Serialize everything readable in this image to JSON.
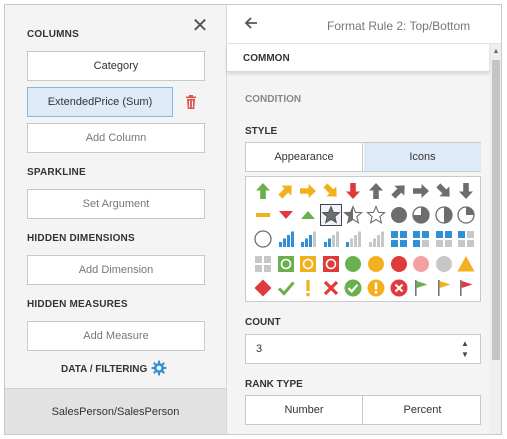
{
  "left_panel": {
    "columns_title": "COLUMNS",
    "columns": [
      "Category",
      "ExtendedPrice (Sum)"
    ],
    "add_column": "Add Column",
    "sparkline_title": "SPARKLINE",
    "set_argument": "Set Argument",
    "hidden_dimensions_title": "HIDDEN DIMENSIONS",
    "add_dimension": "Add Dimension",
    "hidden_measures_title": "HIDDEN MEASURES",
    "add_measure": "Add Measure",
    "data_filtering": "DATA / FILTERING",
    "bottom_item": "SalesPerson/SalesPerson"
  },
  "right_panel": {
    "rule_title": "Format Rule 2: Top/Bottom",
    "common": "COMMON",
    "condition": "CONDITION",
    "style_title": "STYLE",
    "style_tabs": [
      "Appearance",
      "Icons"
    ],
    "active_style_tab": "Icons",
    "count_title": "COUNT",
    "count_value": "3",
    "rank_type_title": "RANK TYPE",
    "rank_options": [
      "Number",
      "Percent"
    ]
  },
  "icons": [
    [
      "arrow-up-green",
      "arrow-up-right-yellow",
      "arrow-right-yellow",
      "arrow-down-right-yellow",
      "arrow-down-red",
      "arrow-up-gray",
      "arrow-up-right-gray",
      "arrow-right-gray",
      "arrow-down-right-gray",
      "arrow-down-gray"
    ],
    [
      "dash-yellow",
      "triangle-down-red",
      "triangle-up-green",
      "star-full",
      "star-half",
      "star-empty",
      "circle-full-gray",
      "circle-three-quarter",
      "circle-half",
      "circle-quarter"
    ],
    [
      "circle-empty",
      "bars-4",
      "bars-3",
      "bars-2",
      "bars-1",
      "bars-0",
      "boxes-4",
      "boxes-3",
      "boxes-2",
      "boxes-1"
    ],
    [
      "boxes-0",
      "square-green",
      "square-yellow",
      "square-red",
      "circle-green",
      "circle-yellow",
      "circle-red",
      "circle-pink",
      "circle-gray",
      "triangle-warning-yellow"
    ],
    [
      "diamond-red",
      "check-green",
      "exclamation-yellow",
      "cross-red",
      "check-circle-green",
      "exclamation-circle-yellow",
      "cross-circle-red",
      "flag-green",
      "flag-yellow",
      "flag-red"
    ]
  ],
  "selected_icon": "star-full",
  "colors": {
    "green": "#6ab04c",
    "yellow": "#f2b01e",
    "red": "#e03b3b",
    "gray": "#6d6d6d",
    "light_gray": "#c7c7c7",
    "blue": "#2f8fd8",
    "selection": "#dfeaf8"
  }
}
